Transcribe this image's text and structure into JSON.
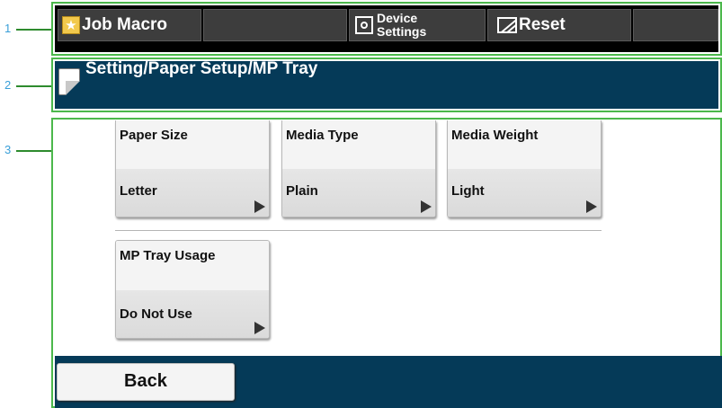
{
  "callouts": [
    "1",
    "2",
    "3"
  ],
  "toolbar": {
    "job_macro": {
      "label": "Job Macro",
      "icon": "star-icon"
    },
    "device_settings": {
      "line1": "Device",
      "line2": "Settings",
      "icon": "gear-icon"
    },
    "reset": {
      "label": "Reset",
      "icon": "reset-icon"
    }
  },
  "header": {
    "title": "Setting/Paper Setup/MP Tray",
    "icon": "document-icon"
  },
  "tiles": [
    {
      "label": "Paper Size",
      "value": "Letter"
    },
    {
      "label": "Media Type",
      "value": "Plain"
    },
    {
      "label": "Media Weight",
      "value": "Light"
    },
    {
      "label": "MP Tray Usage",
      "value": "Do Not Use"
    }
  ],
  "footer": {
    "back_label": "Back"
  },
  "colors": {
    "frame_green": "#4cb84c",
    "callout_blue": "#3a9fd8",
    "header_navy": "#053a58",
    "toolbar_black": "#000000",
    "toolbar_button": "#3d3d3d"
  }
}
